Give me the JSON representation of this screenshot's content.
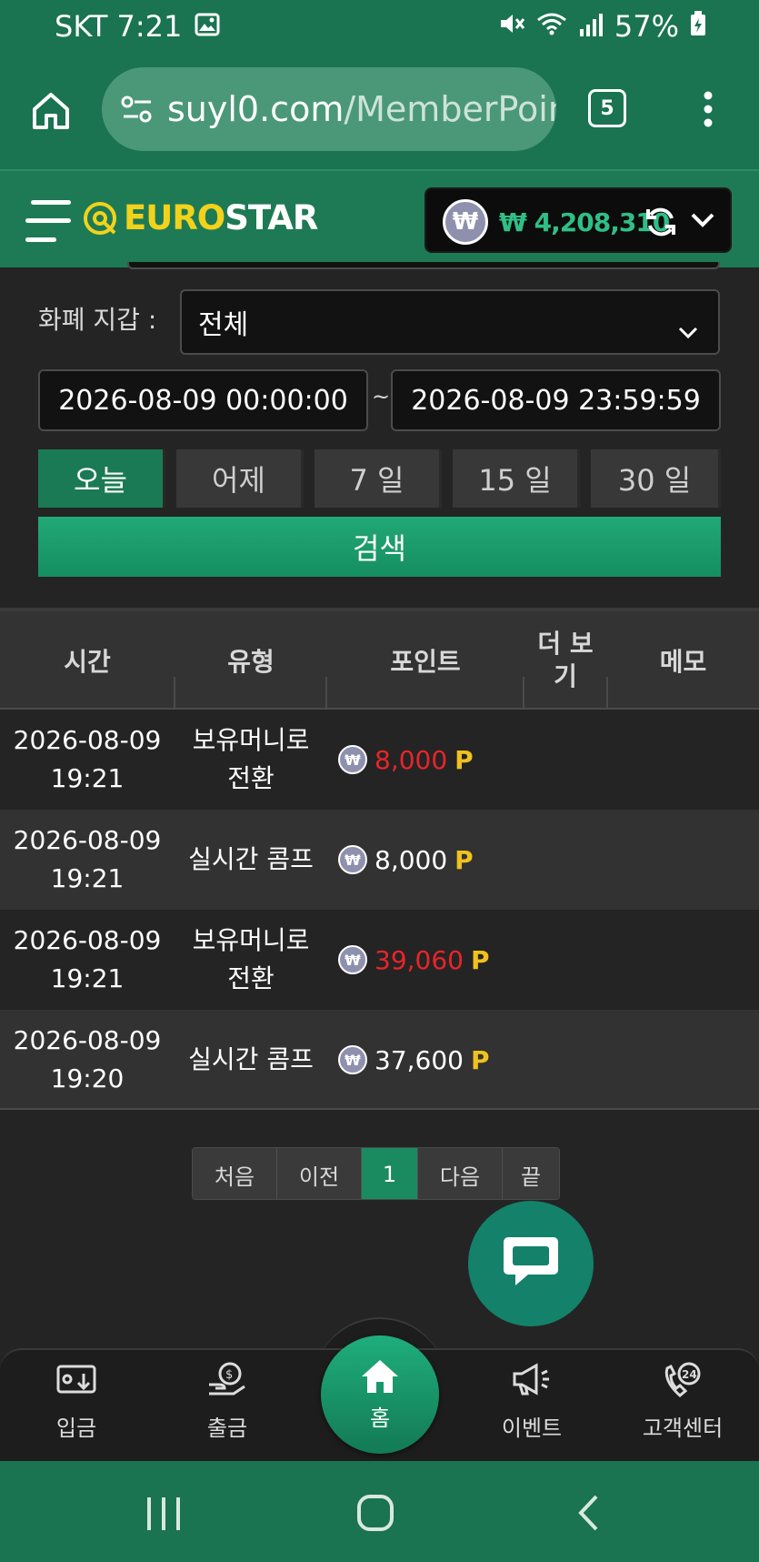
{
  "status_bar": {
    "carrier_time": "SKT 7:21",
    "battery": "57%"
  },
  "browser": {
    "url_host": "suyl0.com",
    "url_path": "/MemberPoin",
    "tab_count": "5"
  },
  "header": {
    "logo_euro": "EURO",
    "logo_star": "STAR",
    "currency_symbol": "₩",
    "balance": "₩ 4,208,310"
  },
  "filter": {
    "wallet_label": "화폐 지갑 :",
    "wallet_value": "전체",
    "date_from": "2026-08-09 00:00:00",
    "date_sep": "~",
    "date_to": "2026-08-09 23:59:59",
    "periods": [
      "오늘",
      "어제",
      "7 일",
      "15 일",
      "30 일"
    ],
    "search_label": "검색"
  },
  "table": {
    "headers": {
      "time": "시간",
      "type": "유형",
      "point": "포인트",
      "more": "더 보\n기",
      "memo": "메모"
    },
    "rows": [
      {
        "date": "2026-08-09",
        "time": "19:21",
        "type": "보유머니로\n전환",
        "amount": "8,000",
        "unit": "P",
        "amount_color": "#e8242a"
      },
      {
        "date": "2026-08-09",
        "time": "19:21",
        "type": "실시간 콤프",
        "amount": "8,000",
        "unit": "P",
        "amount_color": "#ffffff"
      },
      {
        "date": "2026-08-09",
        "time": "19:21",
        "type": "보유머니로\n전환",
        "amount": "39,060",
        "unit": "P",
        "amount_color": "#e8242a"
      },
      {
        "date": "2026-08-09",
        "time": "19:20",
        "type": "실시간 콤프",
        "amount": "37,600",
        "unit": "P",
        "amount_color": "#ffffff"
      }
    ]
  },
  "pagination": {
    "first": "처음",
    "prev": "이전",
    "current": "1",
    "next": "다음",
    "last": "끝"
  },
  "bottom_nav": {
    "deposit": "입금",
    "withdraw": "출금",
    "home": "홈",
    "event": "이벤트",
    "support": "고객센터"
  },
  "colors": {
    "brand_green": "#1a7351",
    "accent": "#22a877",
    "point_unit": "#f0c21c",
    "negative": "#e8242a"
  }
}
